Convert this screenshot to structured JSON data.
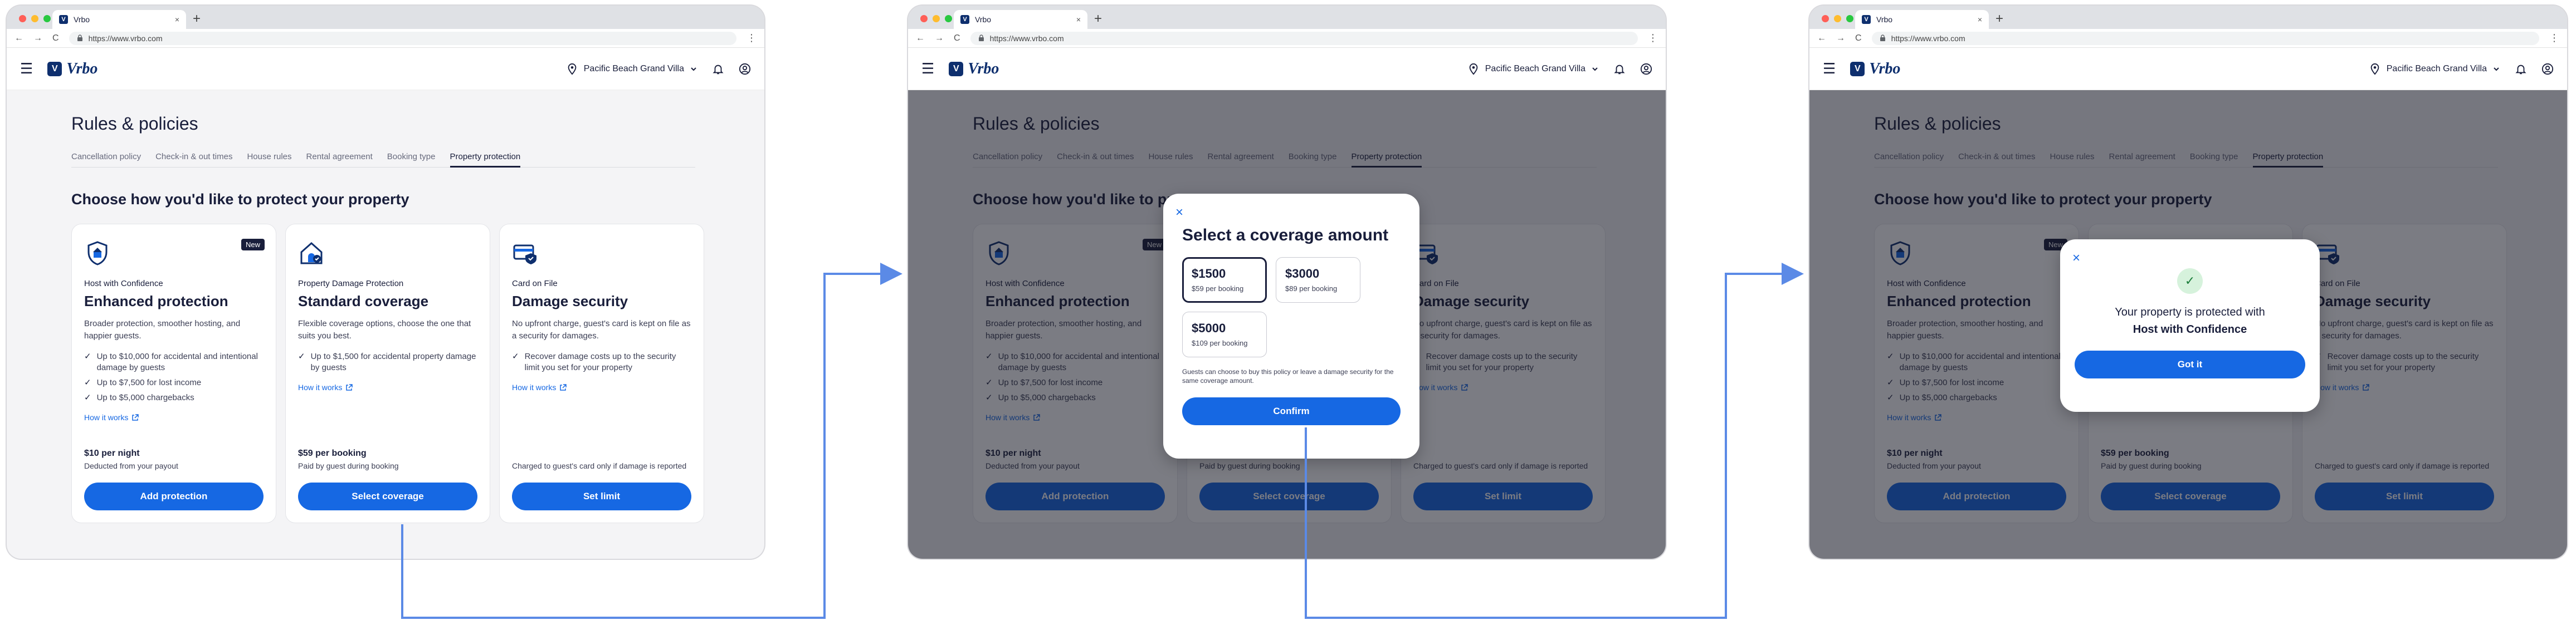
{
  "browser": {
    "tab_title": "Vrbo",
    "tab_close": "×",
    "new_tab": "+",
    "url": "https://www.vrbo.com",
    "back": "←",
    "forward": "→",
    "reload": "C",
    "menu": "⋮"
  },
  "header": {
    "logo_mark": "V",
    "logo_text": "Vrbo",
    "property": "Pacific Beach Grand Villa"
  },
  "page": {
    "title": "Rules & policies",
    "tabs": [
      {
        "label": "Cancellation policy"
      },
      {
        "label": "Check-in & out times"
      },
      {
        "label": "House rules"
      },
      {
        "label": "Rental agreement"
      },
      {
        "label": "Booking type"
      },
      {
        "label": "Property protection"
      }
    ],
    "active_tab": "Property protection",
    "section_title": "Choose how you'd like to protect your property"
  },
  "cards": [
    {
      "badge": "New",
      "kicker": "Host with Confidence",
      "title": "Enhanced protection",
      "desc": "Broader protection, smoother hosting, and happier guests.",
      "bullets": [
        "Up to $10,000 for accidental and intentional damage by guests",
        "Up to $7,500 for lost income",
        "Up to $5,000 chargebacks"
      ],
      "how_link": "How it works",
      "price": "$10 per night",
      "price_sub": "Deducted from your payout",
      "button": "Add protection"
    },
    {
      "badge": "",
      "kicker": "Property Damage Protection",
      "title": "Standard coverage",
      "desc": "Flexible coverage options, choose the one that suits you best.",
      "bullets": [
        "Up to $1,500 for accidental property damage by guests"
      ],
      "how_link": "How it works",
      "price": "$59 per booking",
      "price_sub": "Paid by guest during booking",
      "button": "Select coverage"
    },
    {
      "badge": "",
      "kicker": "Card on File",
      "title": "Damage security",
      "desc": "No upfront charge, guest's card is kept on file as a security for damages.",
      "bullets": [
        "Recover damage costs up to the security limit you set for your property"
      ],
      "how_link": "How it works",
      "price": "",
      "price_sub": "Charged to guest's card only if damage is reported",
      "button": "Set limit"
    }
  ],
  "coverage_modal": {
    "close": "×",
    "title": "Select a coverage amount",
    "options": [
      {
        "amount": "$1500",
        "sub": "$59 per booking",
        "selected": true
      },
      {
        "amount": "$3000",
        "sub": "$89 per booking",
        "selected": false
      },
      {
        "amount": "$5000",
        "sub": "$109 per booking",
        "selected": false
      }
    ],
    "note": "Guests can choose to buy this policy or leave a damage security for the same coverage amount.",
    "confirm": "Confirm"
  },
  "success_modal": {
    "close": "×",
    "check": "✓",
    "line": "Your property is protected with",
    "strong": "Host with Confidence",
    "button": "Got it"
  },
  "colors": {
    "primary": "#1668e3",
    "brand": "#0e2f6e",
    "text": "#191e3b",
    "flow_arrow": "#5b8ae6"
  }
}
